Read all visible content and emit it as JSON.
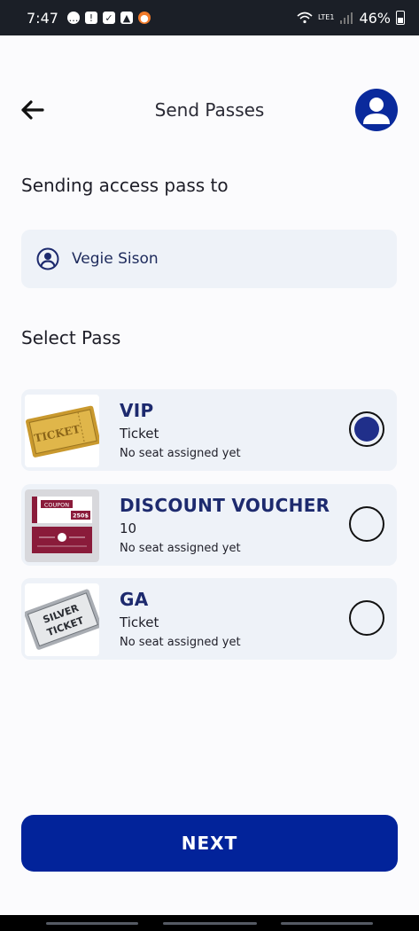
{
  "status_bar": {
    "time": "7:47",
    "battery": "46%",
    "network": "LTE1",
    "icons": [
      "message-icon",
      "warning-icon",
      "checkbox-icon",
      "image-icon",
      "app-icon",
      "wifi-icon",
      "signal-icon",
      "battery-icon"
    ]
  },
  "header": {
    "title": "Send Passes",
    "back_icon": "arrow-left-icon",
    "avatar_icon": "user-avatar-icon"
  },
  "recipient": {
    "label": "Sending access pass to",
    "name": "Vegie Sison"
  },
  "select_label": "Select Pass",
  "passes": [
    {
      "name": "VIP",
      "type": "Ticket",
      "seat": "No seat assigned yet",
      "selected": true,
      "thumb_text": "TICKET"
    },
    {
      "name": "DISCOUNT VOUCHER",
      "type": "10",
      "seat": "No seat assigned yet",
      "selected": false,
      "thumb_text": "COUPON",
      "thumb_price": "250$"
    },
    {
      "name": "GA",
      "type": "Ticket",
      "seat": "No seat assigned yet",
      "selected": false,
      "thumb_text": "SILVER TICKET"
    }
  ],
  "next_label": "NEXT",
  "colors": {
    "primary": "#02239a",
    "card_bg": "#eef2f8",
    "radio_fill": "#202f8a"
  }
}
